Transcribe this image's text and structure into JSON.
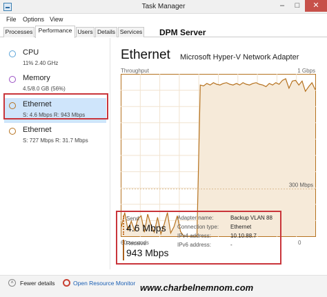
{
  "window": {
    "title": "Task Manager"
  },
  "menu": [
    "File",
    "Options",
    "View"
  ],
  "tabs": [
    "Processes",
    "Performance",
    "Users",
    "Details",
    "Services"
  ],
  "overlay_label": "DPM Server",
  "sidebar": {
    "items": [
      {
        "title": "CPU",
        "sub": "11%  2.40 GHz",
        "color": "#5aa3d8"
      },
      {
        "title": "Memory",
        "sub": "4.5/8.0 GB (56%)",
        "color": "#9a4fc4"
      },
      {
        "title": "Ethernet",
        "sub": "S: 4.6 Mbps  R: 943 Mbps",
        "color": "#b5711e"
      },
      {
        "title": "Ethernet",
        "sub": "S: 727 Mbps  R: 31.7 Mbps",
        "color": "#b5711e"
      }
    ]
  },
  "main": {
    "title": "Ethernet",
    "adapter": "Microsoft Hyper-V Network Adapter",
    "throughput_label": "Throughput",
    "max_label": "1 Gbps",
    "mid_label": "300 Mbps",
    "time_label": "60 seconds",
    "zero_label": "0"
  },
  "chart_data": {
    "type": "area",
    "title": "Throughput",
    "xlabel": "60 seconds",
    "ylabel": "",
    "ylim_mbps": [
      0,
      1000
    ],
    "series": [
      {
        "values": [
          60,
          150,
          40,
          95,
          35,
          110,
          130,
          25,
          140,
          70,
          25,
          120,
          15,
          75,
          150,
          20,
          60,
          130,
          30,
          0,
          0,
          0,
          0,
          0,
          960,
          955,
          970,
          960,
          975,
          965,
          960,
          970,
          975,
          965,
          960,
          970,
          960,
          975,
          965,
          960,
          970,
          975,
          965,
          960,
          950,
          970,
          960,
          975,
          965,
          990,
          1000,
          940,
          985,
          990,
          960,
          985,
          920,
          950,
          975,
          930
        ]
      }
    ]
  },
  "stats": {
    "send_label": "Send",
    "send_value": "4.6 Mbps",
    "receive_label": "Receive",
    "receive_value": "943 Mbps"
  },
  "details": [
    {
      "key": "Adapter name:",
      "value": "Backup VLAN 88"
    },
    {
      "key": "Connection type:",
      "value": "Ethernet"
    },
    {
      "key": "IPv4 address:",
      "value": "10.10.88.7"
    },
    {
      "key": "IPv6 address:",
      "value": "-"
    }
  ],
  "footer": {
    "fewer_details": "Fewer details",
    "open_resource_monitor": "Open Resource Monitor"
  },
  "watermark": "www.charbelnemnom.com",
  "colors": {
    "graph_stroke": "#b5711e",
    "graph_fill": "#f6ead9",
    "highlight": "#c9343a"
  }
}
